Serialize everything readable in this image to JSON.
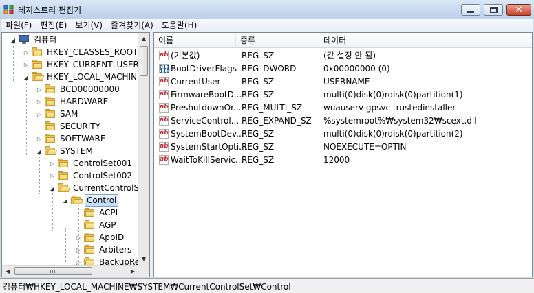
{
  "window": {
    "title": "레지스트리 편집기"
  },
  "menu": [
    "파일(F)",
    "편집(E)",
    "보기(V)",
    "즐겨찾기(A)",
    "도움말(H)"
  ],
  "tree": [
    {
      "label": "컴퓨터",
      "icon": "computer-icon",
      "expander": "open"
    },
    {
      "label": "HKEY_CLASSES_ROOT",
      "expander": "closed"
    },
    {
      "label": "HKEY_CURRENT_USER",
      "expander": "closed"
    },
    {
      "label": "HKEY_LOCAL_MACHINE",
      "expander": "open"
    },
    {
      "label": "BCD00000000",
      "expander": "closed"
    },
    {
      "label": "HARDWARE",
      "expander": "closed"
    },
    {
      "label": "SAM",
      "expander": "closed"
    },
    {
      "label": "SECURITY",
      "expander": "none"
    },
    {
      "label": "SOFTWARE",
      "expander": "closed"
    },
    {
      "label": "SYSTEM",
      "expander": "open"
    },
    {
      "label": "ControlSet001",
      "expander": "closed"
    },
    {
      "label": "ControlSet002",
      "expander": "closed"
    },
    {
      "label": "CurrentControlSet",
      "expander": "open"
    },
    {
      "label": "Control",
      "expander": "open",
      "selected": true
    },
    {
      "label": "ACPI",
      "expander": "none"
    },
    {
      "label": "AGP",
      "expander": "none"
    },
    {
      "label": "AppID",
      "expander": "closed"
    },
    {
      "label": "Arbiters",
      "expander": "closed"
    },
    {
      "label": "BackupRes",
      "expander": "closed"
    }
  ],
  "list": {
    "columns": [
      "이름",
      "종류",
      "데이터"
    ],
    "rows": [
      {
        "icon": "ab",
        "name": "(기본값)",
        "type": "REG_SZ",
        "data": "(값 설정 안 됨)"
      },
      {
        "icon": "bin",
        "name": "BootDriverFlags",
        "type": "REG_DWORD",
        "data": "0x00000000 (0)"
      },
      {
        "icon": "ab",
        "name": "CurrentUser",
        "type": "REG_SZ",
        "data": "USERNAME"
      },
      {
        "icon": "ab",
        "name": "FirmwareBootD...",
        "type": "REG_SZ",
        "data": "multi(0)disk(0)rdisk(0)partition(1)"
      },
      {
        "icon": "ab",
        "name": "PreshutdownOr...",
        "type": "REG_MULTI_SZ",
        "data": "wuauserv gpsvc trustedinstaller"
      },
      {
        "icon": "ab",
        "name": "ServiceControl...",
        "type": "REG_EXPAND_SZ",
        "data": "%systemroot%₩system32₩scext.dll"
      },
      {
        "icon": "ab",
        "name": "SystemBootDev...",
        "type": "REG_SZ",
        "data": "multi(0)disk(0)rdisk(0)partition(2)"
      },
      {
        "icon": "ab",
        "name": "SystemStartOpti...",
        "type": "REG_SZ",
        "data": " NOEXECUTE=OPTIN"
      },
      {
        "icon": "ab",
        "name": "WaitToKillServic...",
        "type": "REG_SZ",
        "data": "12000"
      }
    ]
  },
  "status": "컴퓨터₩HKEY_LOCAL_MACHINE₩SYSTEM₩CurrentControlSet₩Control",
  "icon_glyphs": {
    "ab": "ab",
    "bin": "011\n110"
  }
}
